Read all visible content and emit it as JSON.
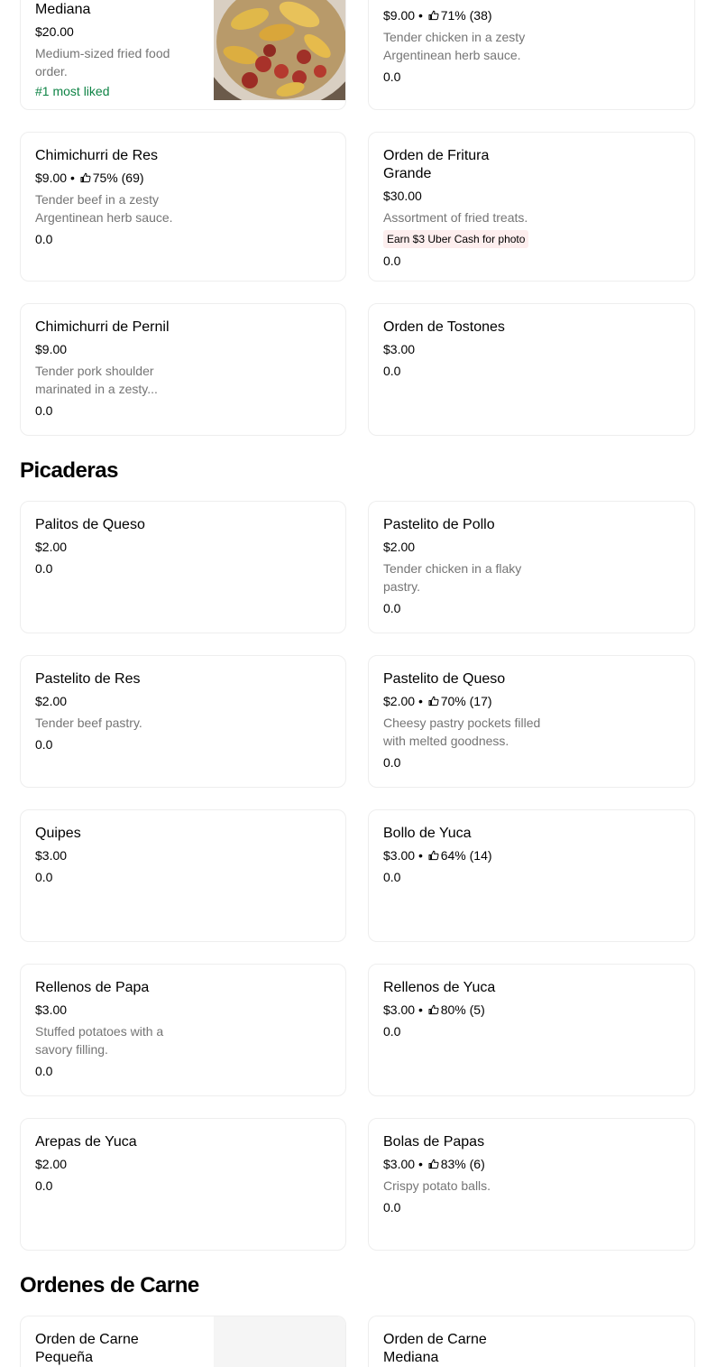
{
  "cards": {
    "mediana": {
      "name": "Mediana",
      "price": "$20.00",
      "desc": "Medium-sized fried food order.",
      "badge": "#1 most liked"
    },
    "chimichurri_pollo": {
      "price": "$9.00",
      "rating": "71% (38)",
      "desc": "Tender chicken in a zesty Argentinean herb sauce.",
      "score": "0.0"
    },
    "chimichurri_res": {
      "name": "Chimichurri de Res",
      "price": "$9.00",
      "rating": "75% (69)",
      "desc": "Tender beef in a zesty Argentinean herb sauce.",
      "score": "0.0"
    },
    "fritura_grande": {
      "name": "Orden de Fritura Grande",
      "price": "$30.00",
      "desc": "Assortment of fried treats.",
      "promo": "Earn $3 Uber Cash for photo",
      "score": "0.0"
    },
    "chimichurri_pernil": {
      "name": "Chimichurri de Pernil",
      "price": "$9.00",
      "desc": "Tender pork shoulder marinated in a zesty...",
      "score": "0.0"
    },
    "tostones": {
      "name": "Orden de Tostones",
      "price": "$3.00",
      "score": "0.0"
    },
    "palitos_queso": {
      "name": "Palitos de Queso",
      "price": "$2.00",
      "score": "0.0"
    },
    "pastelito_pollo": {
      "name": "Pastelito de Pollo",
      "price": "$2.00",
      "desc": "Tender chicken in a flaky pastry.",
      "score": "0.0"
    },
    "pastelito_res": {
      "name": "Pastelito de Res",
      "price": "$2.00",
      "desc": "Tender beef pastry.",
      "score": "0.0"
    },
    "pastelito_queso": {
      "name": "Pastelito de Queso",
      "price": "$2.00",
      "rating": "70% (17)",
      "desc": "Cheesy pastry pockets filled with melted goodness.",
      "score": "0.0"
    },
    "quipes": {
      "name": "Quipes",
      "price": "$3.00",
      "score": "0.0"
    },
    "bollo_yuca": {
      "name": "Bollo de Yuca",
      "price": "$3.00",
      "rating": "64% (14)",
      "score": "0.0"
    },
    "rellenos_papa": {
      "name": "Rellenos de Papa",
      "price": "$3.00",
      "desc": "Stuffed potatoes with a savory filling.",
      "score": "0.0"
    },
    "rellenos_yuca": {
      "name": "Rellenos de Yuca",
      "price": "$3.00",
      "rating": "80% (5)",
      "score": "0.0"
    },
    "arepas_yuca": {
      "name": "Arepas de Yuca",
      "price": "$2.00",
      "score": "0.0"
    },
    "bolas_papas": {
      "name": "Bolas de Papas",
      "price": "$3.00",
      "rating": "83% (6)",
      "desc": "Crispy potato balls.",
      "score": "0.0"
    },
    "carne_pequena": {
      "name": "Orden de Carne Pequeña"
    },
    "carne_mediana": {
      "name": "Orden de Carne Mediana"
    }
  },
  "sections": {
    "picaderas": "Picaderas",
    "ordenes_carne": "Ordenes de Carne"
  },
  "symbols": {
    "dot": "•"
  },
  "icons": {
    "thumbs_up": "thumbs-up-icon"
  },
  "colors": {
    "badge_green": "#0e8345",
    "promo_bg": "#fdeeee",
    "desc_gray": "#757575",
    "card_border": "#eeeeee"
  }
}
